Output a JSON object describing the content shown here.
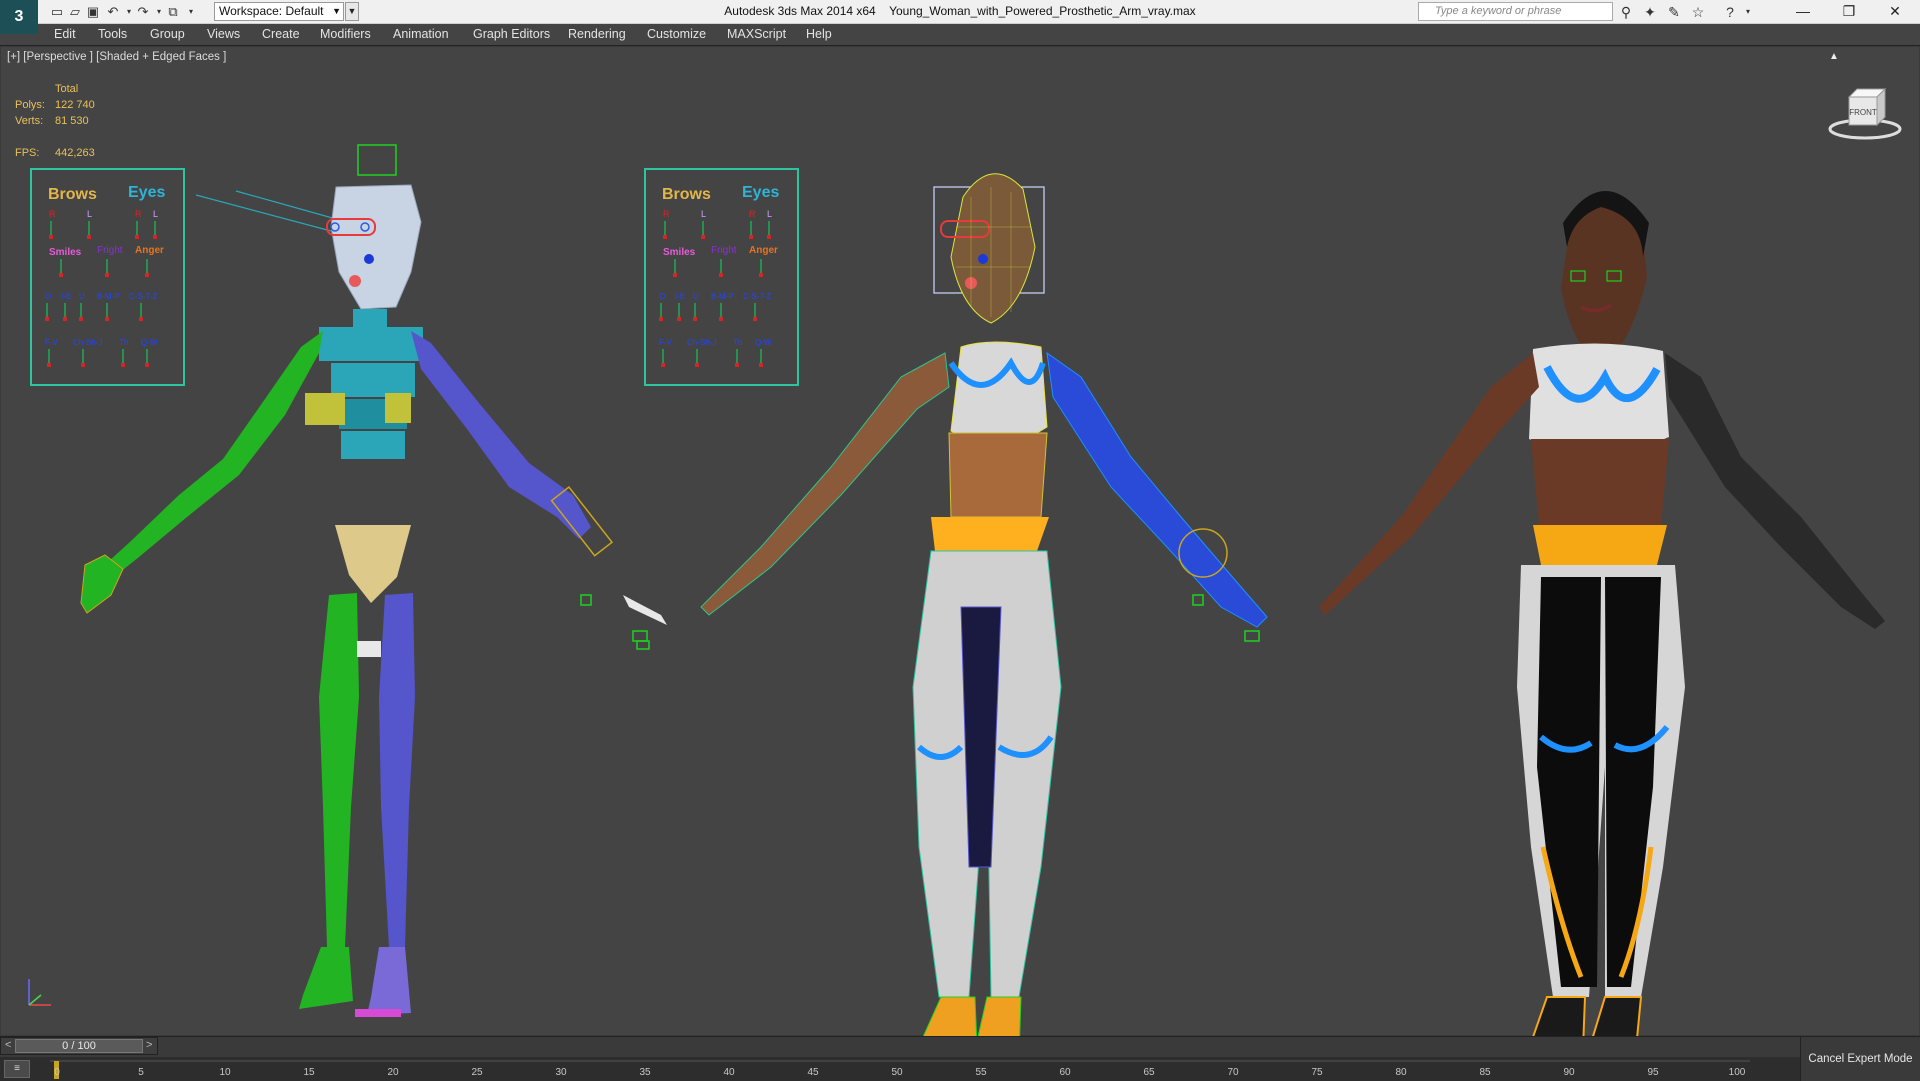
{
  "app": {
    "logo": "3ds-max-logo",
    "title": "Autodesk 3ds Max  2014 x64",
    "file": "Young_Woman_with_Powered_Prosthetic_Arm_vray.max"
  },
  "toolbar": {
    "workspace_label": "Workspace: Default",
    "search_placeholder": "Type a keyword or phrase",
    "icons": [
      "new-icon",
      "open-icon",
      "save-icon",
      "undo-icon",
      "redo-icon",
      "project-icon",
      "binoculars-icon",
      "subscription-icon",
      "communication-icon",
      "favorites-icon",
      "help-icon"
    ]
  },
  "window_buttons": {
    "minimize": "—",
    "restore": "❐",
    "close": "✕"
  },
  "menu": [
    "Edit",
    "Tools",
    "Group",
    "Views",
    "Create",
    "Modifiers",
    "Animation",
    "Graph Editors",
    "Rendering",
    "Customize",
    "MAXScript",
    "Help"
  ],
  "viewport": {
    "label": "[+] [Perspective ] [Shaded + Edged Faces ]",
    "stats": {
      "header": "Total",
      "polys_label": "Polys:",
      "polys": "122 740",
      "verts_label": "Verts:",
      "verts": "81 530",
      "fps_label": "FPS:",
      "fps": "442,263"
    },
    "viewcube_label": "FRONT",
    "facial_panel": {
      "brows": "Brows",
      "eyes": "Eyes",
      "r": "R",
      "l": "L",
      "smiles": "Smiles",
      "fright": "Fright",
      "anger": "Anger",
      "row1": [
        "O",
        "I-E",
        "U",
        "B-M-P",
        "C-S-T-Z"
      ],
      "row2": [
        "F-V",
        "Ch-Sh-J",
        "Th",
        "Q-W"
      ]
    },
    "colors": {
      "rig_green": "#22b422",
      "rig_blue": "#5555cc",
      "rig_cyan": "#2aa6b8",
      "panel_border": "#2ec4a0",
      "stats_text": "#e9c15a"
    }
  },
  "timeline": {
    "frame_display": "0 / 100",
    "prev": "<",
    "next": ">",
    "ticks": [
      "0",
      "5",
      "10",
      "15",
      "20",
      "25",
      "30",
      "35",
      "40",
      "45",
      "50",
      "55",
      "60",
      "65",
      "70",
      "75",
      "80",
      "85",
      "90",
      "95",
      "100"
    ],
    "cancel_expert": "Cancel Expert Mode"
  }
}
